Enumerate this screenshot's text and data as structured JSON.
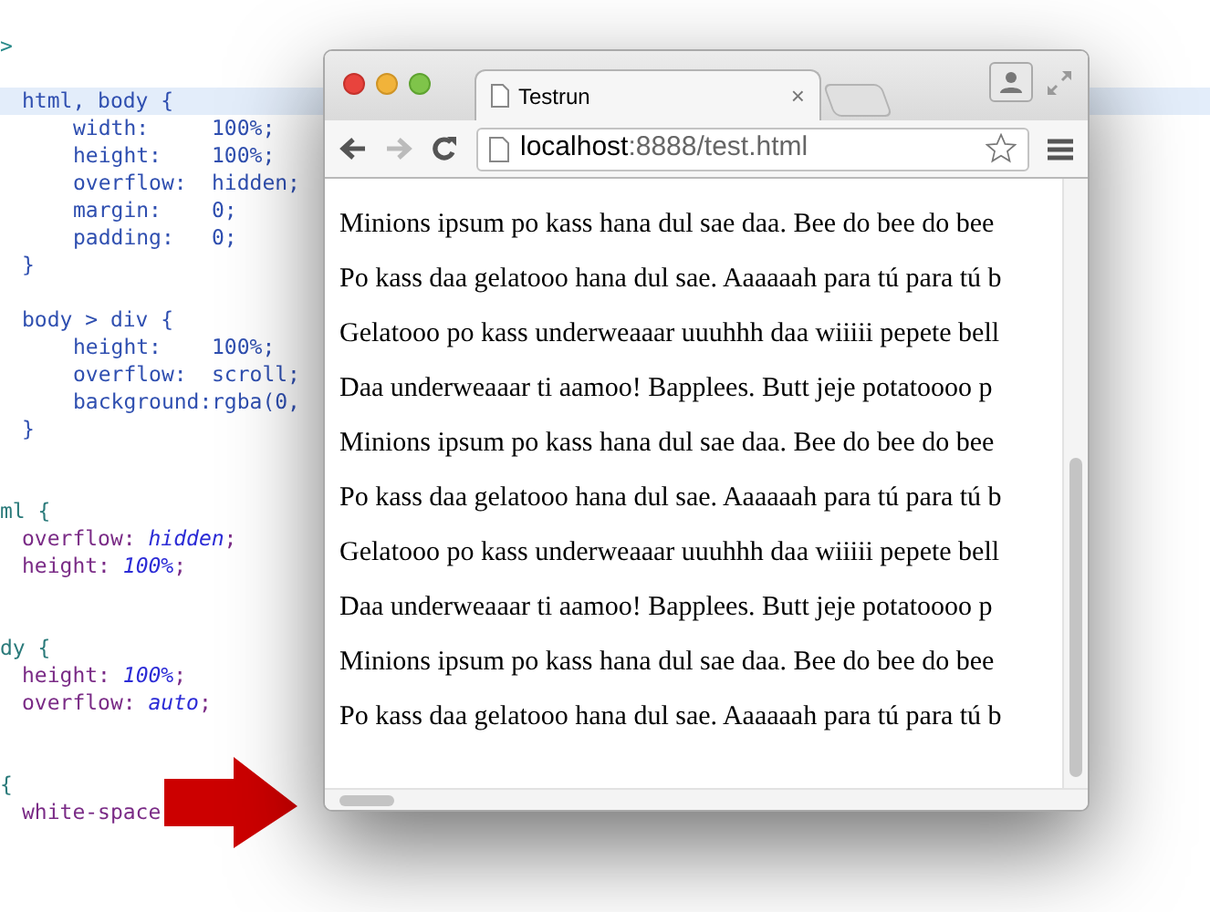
{
  "code_editor": {
    "blocks": [
      {
        "kind": "plain",
        "lines": [
          {
            "kind": "tag",
            "text": ">"
          },
          {
            "kind": "blank"
          },
          {
            "kind": "selector",
            "text": "html, body {",
            "selected": true
          },
          {
            "kind": "declaration",
            "property": "width:",
            "value": "100%;"
          },
          {
            "kind": "declaration",
            "property": "height:",
            "value": "100%;"
          },
          {
            "kind": "declaration",
            "property": "overflow:",
            "value": "hidden;"
          },
          {
            "kind": "declaration",
            "property": "margin:",
            "value": "0;"
          },
          {
            "kind": "declaration",
            "property": "padding:",
            "value": "0;"
          },
          {
            "kind": "close",
            "text": "}"
          },
          {
            "kind": "blank"
          },
          {
            "kind": "selector",
            "text": "body > div {",
            "selected": false
          },
          {
            "kind": "declaration",
            "property": "height:",
            "value": "100%;"
          },
          {
            "kind": "declaration",
            "property": "overflow:",
            "value": "scroll;"
          },
          {
            "kind": "declaration",
            "property": "background:",
            "value": "rgba(0,"
          },
          {
            "kind": "close",
            "text": "}"
          },
          {
            "kind": "blank"
          },
          {
            "kind": "blank"
          }
        ]
      },
      {
        "kind": "syntax",
        "lines": [
          {
            "kind": "selector",
            "text": "ml {",
            "selected": false
          },
          {
            "kind": "declaration",
            "property": "overflow:",
            "value": "hidden",
            "end": ";"
          },
          {
            "kind": "declaration",
            "property": "height:",
            "value": "100%",
            "end": ";"
          },
          {
            "kind": "blank"
          },
          {
            "kind": "blank"
          },
          {
            "kind": "selector",
            "text": "dy {",
            "selected": false
          },
          {
            "kind": "declaration",
            "property": "height:",
            "value": "100%",
            "end": ";"
          },
          {
            "kind": "declaration",
            "property": "overflow:",
            "value": "auto",
            "end": ";"
          },
          {
            "kind": "blank"
          },
          {
            "kind": "blank"
          },
          {
            "kind": "selector",
            "text": "{",
            "selected": false
          },
          {
            "kind": "declaration",
            "property": "white-space"
          }
        ]
      }
    ]
  },
  "browser": {
    "tabs": [
      {
        "title": "Testrun",
        "close_label": "×",
        "selected": true
      }
    ],
    "url": {
      "host": "localhost",
      "rest": ":8888/test.html"
    },
    "content": [
      "Minions ipsum po kass hana dul sae daa. Bee do bee do bee",
      "Po kass daa gelatooo hana dul sae. Aaaaaah para tú para tú b",
      "Gelatooo po kass underweaaar uuuhhh daa wiiiii pepete bell",
      "Daa underweaaar ti aamoo! Bapplees. Butt jeje potatoooo p",
      "Minions ipsum po kass hana dul sae daa. Bee do bee do bee",
      "Po kass daa gelatooo hana dul sae. Aaaaaah para tú para tú b",
      "Gelatooo po kass underweaaar uuuhhh daa wiiiii pepete bell",
      "Daa underweaaar ti aamoo! Bapplees. Butt jeje potatoooo p",
      "Minions ipsum po kass hana dul sae daa. Bee do bee do bee",
      "Po kass daa gelatooo hana dul sae. Aaaaaah para tú para tú b"
    ]
  }
}
